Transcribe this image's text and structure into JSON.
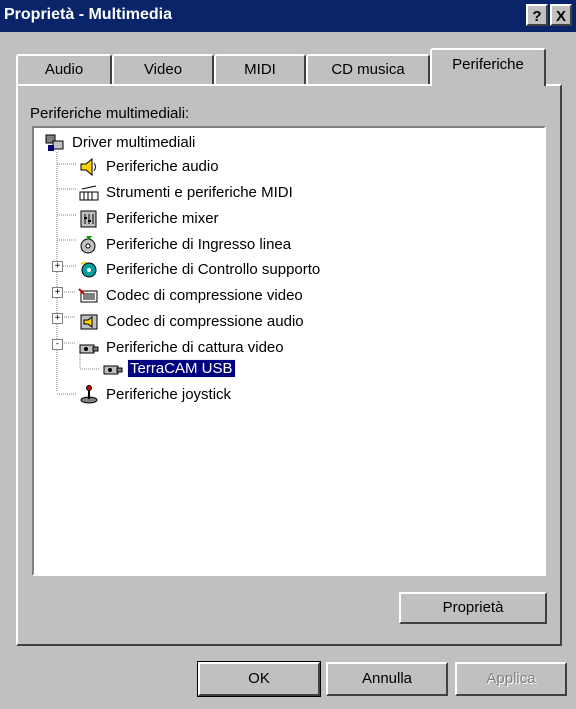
{
  "window": {
    "title": "Proprietà - Multimedia",
    "help_label": "?",
    "close_label": "X"
  },
  "tabs": [
    {
      "label": "Audio"
    },
    {
      "label": "Video"
    },
    {
      "label": "MIDI"
    },
    {
      "label": "CD musica"
    },
    {
      "label": "Periferiche",
      "active": true
    }
  ],
  "group": {
    "label": "Periferiche multimediali:"
  },
  "tree": {
    "root": "Driver multimediali",
    "items": [
      {
        "label": "Periferiche audio",
        "icon": "speaker-icon"
      },
      {
        "label": "Strumenti e periferiche MIDI",
        "icon": "midi-icon"
      },
      {
        "label": "Periferiche mixer",
        "icon": "mixer-icon"
      },
      {
        "label": "Periferiche di Ingresso linea",
        "icon": "line-in-icon"
      },
      {
        "label": "Periferiche di Controllo supporto",
        "icon": "media-control-icon",
        "expander": "+"
      },
      {
        "label": "Codec di compressione video",
        "icon": "video-codec-icon",
        "expander": "+"
      },
      {
        "label": "Codec di compressione audio",
        "icon": "audio-codec-icon",
        "expander": "+"
      },
      {
        "label": "Periferiche di cattura video",
        "icon": "capture-icon",
        "expander": "-"
      },
      {
        "label": "TerraCAM USB",
        "icon": "camera-icon",
        "selected": true
      },
      {
        "label": "Periferiche joystick",
        "icon": "joystick-icon"
      }
    ]
  },
  "buttons": {
    "properties": "Proprietà",
    "ok": "OK",
    "cancel": "Annulla",
    "apply": "Applica"
  },
  "colors": {
    "title_bar": "#0a246a",
    "face": "#c0c0c0",
    "selection": "#000080"
  }
}
